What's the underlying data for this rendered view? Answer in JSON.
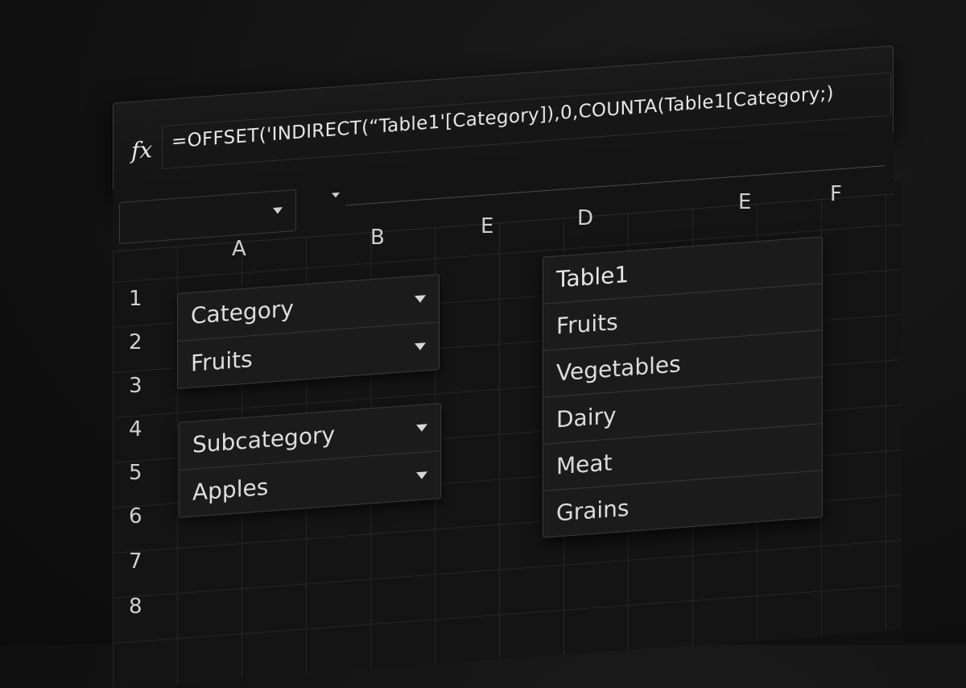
{
  "formula_bar": {
    "fx_label": "fx",
    "formula": "=OFFSET('INDIRECT(“Table1'[Category]),0,COUNTA(Table1[Category;)"
  },
  "columns": [
    "A",
    "B",
    "E",
    "D",
    "E",
    "F"
  ],
  "rows": [
    "1",
    "2",
    "3",
    "4",
    "5",
    "6",
    "7",
    "8"
  ],
  "category_dropdown": {
    "header": "Category",
    "value": "Fruits"
  },
  "subcategory_dropdown": {
    "header": "Subcategory",
    "value": "Apples"
  },
  "table1": {
    "title": "Table1",
    "items": [
      "Fruits",
      "Vegetables",
      "Dairy",
      "Meat",
      "Grains"
    ]
  },
  "icons": {
    "dropdown": "chevron-down-icon",
    "fx": "function-icon"
  }
}
